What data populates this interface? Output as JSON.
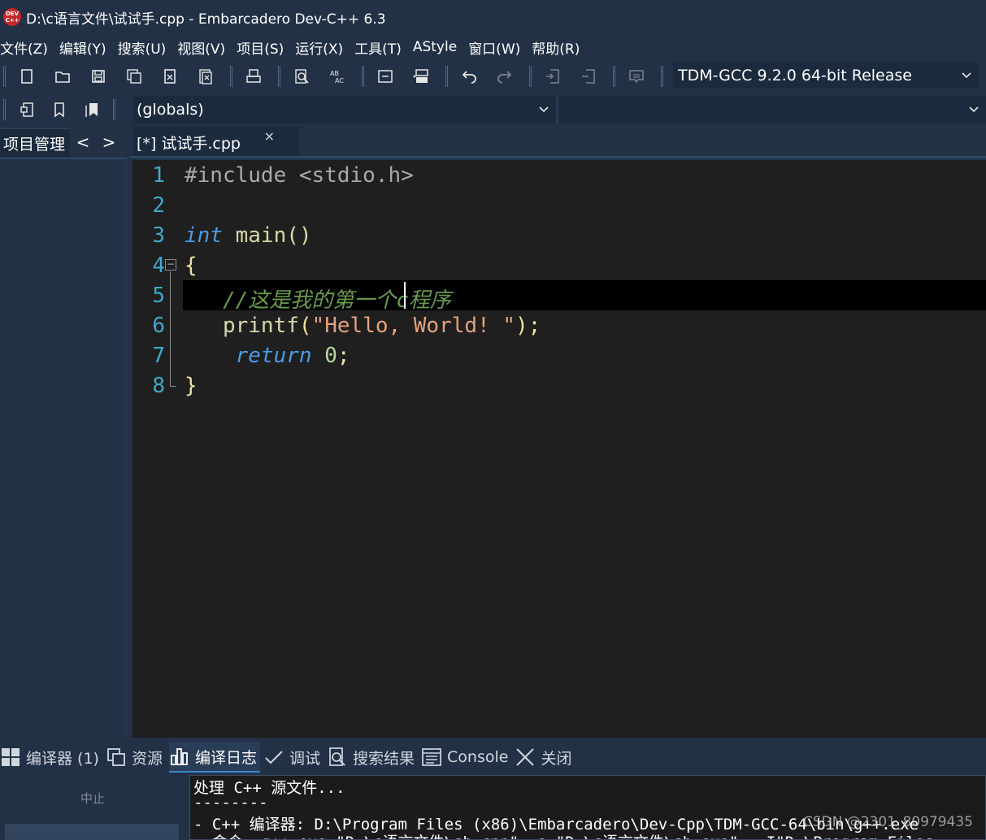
{
  "window": {
    "app_logo_text_1": "DEV",
    "app_logo_text_2": "C++",
    "title": "D:\\c语言文件\\试试手.cpp - Embarcadero Dev-C++ 6.3"
  },
  "menu": {
    "items": [
      "文件(Z)",
      "编辑(Y)",
      "搜索(U)",
      "视图(V)",
      "项目(S)",
      "运行(X)",
      "工具(T)",
      "AStyle",
      "窗口(W)",
      "帮助(R)"
    ]
  },
  "toolbar": {
    "compiler": "TDM-GCC 9.2.0 64-bit Release",
    "scope": "(globals)"
  },
  "left_panel": {
    "tab_label": "项目管理",
    "prev_arrow": "<",
    "next_arrow": ">"
  },
  "editor": {
    "tab_label": "[*] 试试手.cpp",
    "tab_close": "×",
    "line_numbers": [
      "1",
      "2",
      "3",
      "4",
      "5",
      "6",
      "7",
      "8"
    ],
    "fold_symbol": "−",
    "code": {
      "l1_pre": "#include <stdio.h>",
      "l3_kw": "int",
      "l3_rest": " main()",
      "l4": "{",
      "l5_indent": "   ",
      "l5_comment": "//这是我的第一个c程序",
      "l6_indent": "   ",
      "l6_fn": "printf",
      "l6_open": "(",
      "l6_str": "\"Hello, World! \"",
      "l6_close": ");",
      "l7_indent": "    ",
      "l7_kw": "return",
      "l7_sp": " ",
      "l7_num": "0",
      "l7_semi": ";",
      "l8": "}"
    }
  },
  "bottom": {
    "tabs": [
      "编译器 (1)",
      "资源",
      "编译日志",
      "调试",
      "搜索结果",
      "Console",
      "关闭"
    ],
    "active_tab": "编译日志",
    "stop_label": "中止",
    "log_lines": [
      "处理 C++ 源文件...",
      "--------",
      "- C++ 编译器: D:\\Program Files (x86)\\Embarcadero\\Dev-Cpp\\TDM-GCC-64\\bin\\g++.exe",
      "- 命令: g++.exe \"D:\\c语言文件\\sb.cpp\" -o \"D:\\c语言文件\\sb.exe\"  -I\"D:\\Program Files"
    ],
    "watermark": "CSDN @2301_80979435"
  },
  "colors": {
    "background": "#223146",
    "editor_bg": "#1f1f1f",
    "line_number": "#3fa9c9",
    "keyword": "#4c9be3",
    "comment": "#6a9a4e",
    "string": "#e2a37e"
  }
}
